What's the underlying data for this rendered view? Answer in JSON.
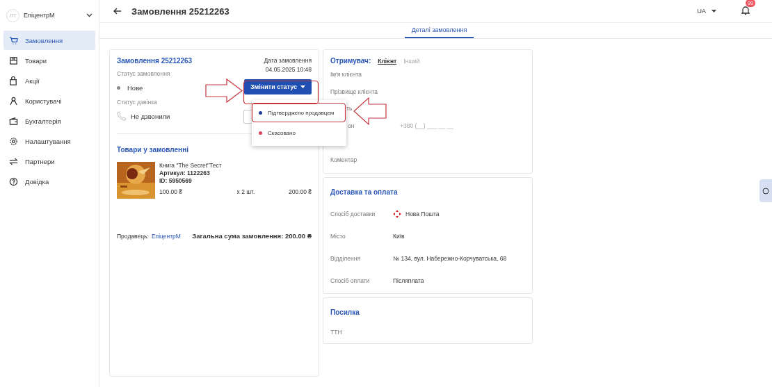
{
  "account": {
    "avatar": "ЛТ",
    "name": "ЕпіцентрМ"
  },
  "sidebar": {
    "items": [
      {
        "label": "Замовлення",
        "selected": true
      },
      {
        "label": "Товари",
        "selected": false
      },
      {
        "label": "Акції",
        "selected": false
      },
      {
        "label": "Користувачі",
        "selected": false
      },
      {
        "label": "Бухгалтерія",
        "selected": false
      },
      {
        "label": "Налаштування",
        "selected": false
      },
      {
        "label": "Партнери",
        "selected": false
      },
      {
        "label": "Довідка",
        "selected": false
      }
    ]
  },
  "header": {
    "title": "Замовлення 25212263",
    "language": "UA",
    "notifications": "99"
  },
  "tabs": [
    {
      "label": "Деталі замовлення",
      "selected": true
    }
  ],
  "order": {
    "title": "Замовлення 25212263",
    "date_label": "Дата замовлення",
    "date": "04.05.2025 10:48",
    "status_label": "Статус замовлення",
    "status": "Нове",
    "change_button": "Змінити статус",
    "call_label": "Статус дзвінка",
    "call_status": "Не дзвонили",
    "menu": [
      {
        "label": "Підтверджено продавцем",
        "color": "#1f3f99"
      },
      {
        "label": "Скасовано",
        "color": "#d9475a"
      }
    ],
    "items_title": "Товари у замовленні",
    "items": [
      {
        "kind": "picture",
        "name": "Книга \"The Secret\"Тест",
        "sku": "Артикул: 1122263",
        "id": "ID: 5950569",
        "price": "100.00 ₴",
        "qty": "x 2 шт.",
        "total": "200.00 ₴"
      }
    ],
    "seller_label": "Продавець:",
    "seller": "ЕпіцентрМ",
    "sum": "Загальна сума замовлення: 200.00 ₴"
  },
  "recipient": {
    "title": "Отримувач:",
    "options": [
      {
        "label": "Клієнт",
        "selected": true
      },
      {
        "label": "Інший",
        "selected": false
      }
    ],
    "fields": [
      {
        "kind": "full",
        "label": "Ім'я клієнта"
      },
      {
        "kind": "full",
        "label": "Прізвище клієнта"
      },
      {
        "kind": "partial",
        "label": "ть"
      },
      {
        "kind": "partial",
        "label": "он",
        "placeholder": "+380 (__) ___ __ __"
      },
      {
        "kind": "hidden"
      },
      {
        "kind": "full",
        "label": "Коментар"
      }
    ]
  },
  "delivery": {
    "title": "Доставка та оплата",
    "rows": [
      {
        "label": "Спосіб доставки",
        "value": "Нова Пошта",
        "logo": true
      },
      {
        "label": "Місто",
        "value": "Київ",
        "logo": false
      },
      {
        "label": "Відділення",
        "value": "№ 134, вул. Набережно-Корчуватська, 68",
        "logo": false
      },
      {
        "label": "Спосіб оплати",
        "value": "Післяплата",
        "logo": false
      }
    ]
  },
  "parcel": {
    "title": "Посилка",
    "rows": [
      "ТТН"
    ]
  }
}
